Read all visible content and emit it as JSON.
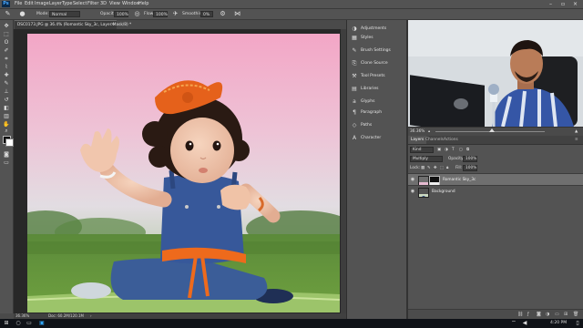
{
  "app": {
    "logo": "Ps",
    "menu": [
      "File",
      "Edit",
      "Image",
      "Layer",
      "Type",
      "Select",
      "Filter",
      "3D",
      "View",
      "Window",
      "Help"
    ]
  },
  "options_bar": {
    "mode_label": "Mode:",
    "mode_value": "Normal",
    "opacity_label": "Opacity:",
    "opacity_value": "100%",
    "flow_label": "Flow:",
    "flow_value": "100%",
    "smoothing_label": "Smoothing:",
    "smoothing_value": "0%"
  },
  "document": {
    "tab_title": "DSC0173.JPG @ 36.4% (Romantic Sky_3c, Layer Mask/8) *",
    "zoom": "36.36%",
    "doc_size": "Doc: 60.2M/120.1M"
  },
  "panel_strip": {
    "items": [
      {
        "icon": "adjustments-icon",
        "glyph": "◑",
        "label": "Adjustments"
      },
      {
        "icon": "styles-icon",
        "glyph": "▦",
        "label": "Styles"
      },
      {
        "icon": "brush-settings-icon",
        "glyph": "✎",
        "label": "Brush Settings"
      },
      {
        "icon": "clone-source-icon",
        "glyph": "⎘",
        "label": "Clone Source"
      },
      {
        "icon": "tool-presets-icon",
        "glyph": "⚒",
        "label": "Tool Presets"
      },
      {
        "icon": "libraries-icon",
        "glyph": "▤",
        "label": "Libraries"
      },
      {
        "icon": "glyphs-icon",
        "glyph": "a",
        "label": "Glyphs"
      },
      {
        "icon": "paragraph-icon",
        "glyph": "¶",
        "label": "Paragraph"
      },
      {
        "icon": "paths-icon",
        "glyph": "◇",
        "label": "Paths"
      },
      {
        "icon": "character-icon",
        "glyph": "A",
        "label": "Character"
      }
    ]
  },
  "navigator": {
    "zoom": "36.36%"
  },
  "layers_panel": {
    "tabs": [
      "Layers",
      "Channels",
      "Actions"
    ],
    "kind_label": "Kind",
    "blend_mode": "Multiply",
    "opacity_label": "Opacity:",
    "opacity_value": "100%",
    "lock_label": "Lock:",
    "fill_label": "Fill:",
    "fill_value": "100%",
    "layers": [
      {
        "name": "Romantic Sky_3c",
        "selected": true,
        "has_mask": true
      },
      {
        "name": "Background",
        "selected": false,
        "has_mask": false
      }
    ]
  },
  "taskbar": {
    "time": "4:20 PM"
  },
  "colors": {
    "ui_panel": "#535353",
    "ui_dark": "#282828",
    "selected_layer": "#6f6f6f"
  }
}
